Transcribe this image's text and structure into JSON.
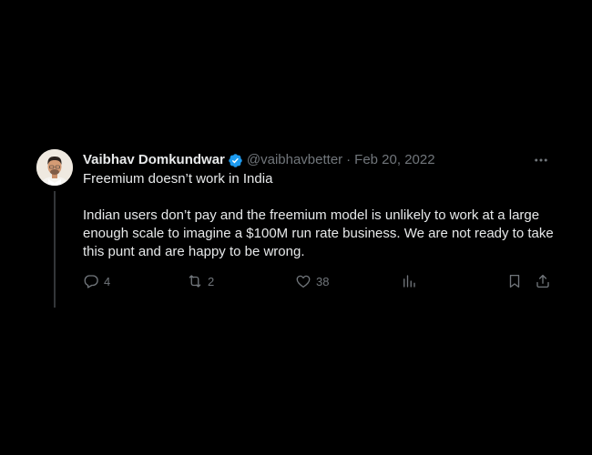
{
  "tweet": {
    "author": {
      "display_name": "Vaibhav Domkundwar",
      "handle": "@vaibhavbetter",
      "verified": true,
      "avatar_icon": "profile-photo"
    },
    "separator": "·",
    "date": "Feb 20, 2022",
    "text": {
      "line1": "Freemium doesn’t work in India",
      "paragraph2": "Indian users don’t pay and the freemium model is unlikely to work at a large enough scale to imagine a $100M run rate business. We are not ready to take this punt and are happy to be wrong."
    },
    "actions": {
      "replies": "4",
      "retweets": "2",
      "likes": "38"
    }
  },
  "colors": {
    "background": "#000000",
    "primary_text": "#e7e9ea",
    "secondary_text": "#71767b",
    "verified_badge": "#1d9bf0",
    "thread_line": "#333639"
  },
  "icons": {
    "more": "more-horizontal-icon",
    "reply": "reply-icon",
    "retweet": "retweet-icon",
    "like": "heart-icon",
    "views": "analytics-icon",
    "bookmark": "bookmark-icon",
    "share": "share-icon"
  }
}
